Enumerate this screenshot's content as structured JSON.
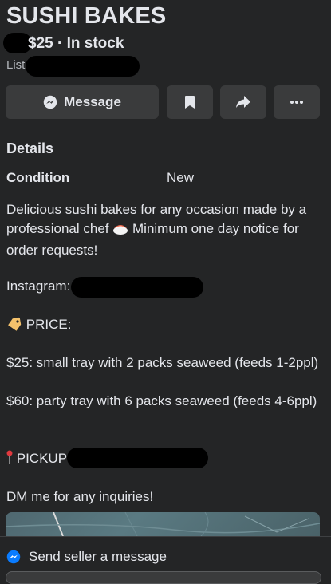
{
  "listing": {
    "title": "SUSHI BAKES",
    "price_stock": "$25 · In stock",
    "listed_prefix": "List"
  },
  "actions": {
    "message_label": "Message"
  },
  "details": {
    "heading": "Details",
    "condition_label": "Condition",
    "condition_value": "New"
  },
  "description": {
    "line1": "Delicious sushi bakes for any occasion made by a professional chef",
    "line1b": "Minimum one day notice for order requests!",
    "instagram": "Instagram:",
    "price_heading": "PRICE:",
    "price_small": "$25: small tray with 2 packs seaweed (feeds 1-2ppl)",
    "price_party": "$60: party tray with 6 packs seaweed (feeds 4-6ppl)",
    "pickup": "PICKUP:",
    "dm": "DM me for any inquiries!"
  },
  "footer": {
    "send_label": "Send seller a message"
  },
  "icons": {
    "message": "messenger-icon",
    "save": "bookmark-icon",
    "share": "share-icon",
    "more": "more-icon"
  },
  "colors": {
    "background": "#242526",
    "button": "#3a3b3c",
    "messenger_blue": "#0a7cff"
  }
}
